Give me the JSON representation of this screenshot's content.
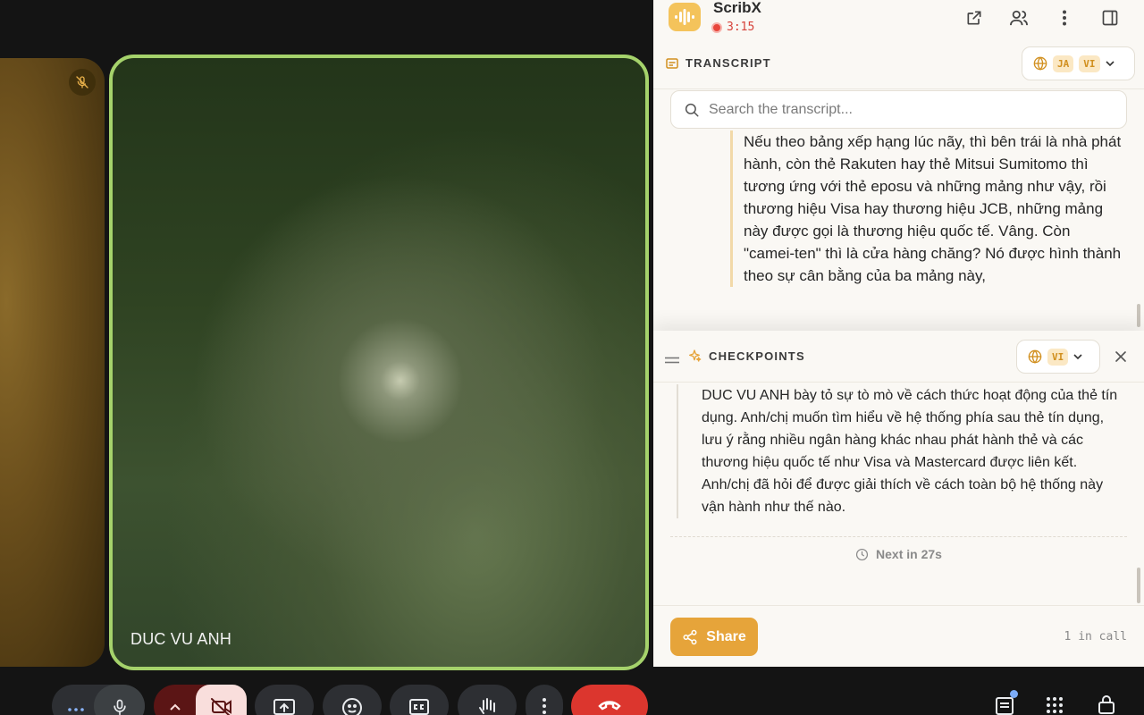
{
  "video": {
    "main_participant": "DUC VU ANH"
  },
  "panel": {
    "app_title": "ScribX",
    "recording_time": "3:15",
    "transcript": {
      "title": "TRANSCRIPT",
      "languages": [
        "JA",
        "VI"
      ],
      "search_placeholder": "Search the transcript...",
      "text": "Nếu theo bảng xếp hạng lúc nãy, thì bên trái là nhà phát hành, còn thẻ Rakuten hay thẻ Mitsui Sumitomo thì tương ứng với thẻ eposu và những mảng như vậy, rồi thương hiệu Visa hay thương hiệu JCB, những mảng này được gọi là thương hiệu quốc tế. Vâng. Còn \"camei-ten\" thì là cửa hàng chăng? Nó được hình thành theo sự cân bằng của ba mảng này,"
    },
    "checkpoints": {
      "title": "CHECKPOINTS",
      "language": "VI",
      "text": "DUC VU ANH bày tỏ sự tò mò về cách thức hoạt động của thẻ tín dụng. Anh/chị muốn tìm hiểu về hệ thống phía sau thẻ tín dụng, lưu ý rằng nhiều ngân hàng khác nhau phát hành thẻ và các thương hiệu quốc tế như Visa và Mastercard được liên kết. Anh/chị đã hỏi để được giải thích về cách toàn bộ hệ thống này vận hành như thế nào.",
      "next": "Next in 27s"
    },
    "footer": {
      "share_label": "Share",
      "in_call": "1 in call"
    }
  },
  "colors": {
    "accent": "#e6a43a",
    "speaker_border": "#a5d26b",
    "leave_red": "#dc362e",
    "recording_red": "#e8463c"
  }
}
